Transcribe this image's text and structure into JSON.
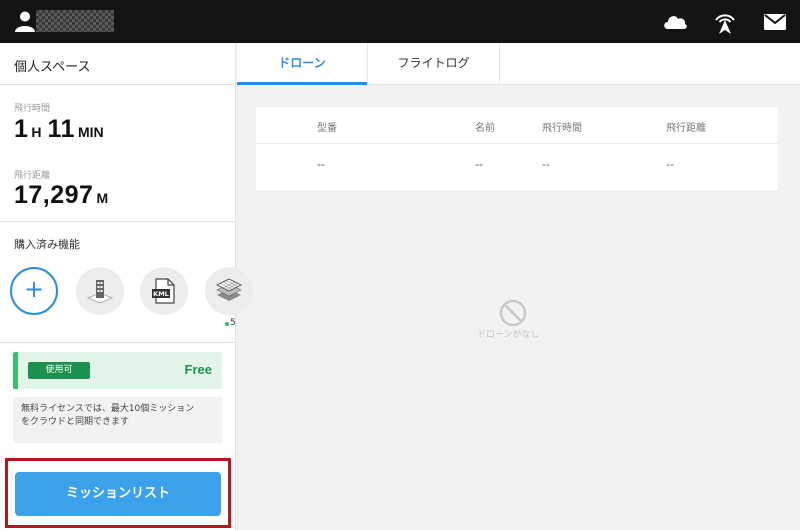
{
  "topbar": {
    "icons": [
      "user-icon",
      "cloud-icon",
      "drone-sync-icon",
      "mail-icon"
    ]
  },
  "sidebar": {
    "title": "個人スペース",
    "flight_time": {
      "label": "飛行時間",
      "hours": "1",
      "hours_unit": "H",
      "minutes": "11",
      "minutes_unit": "MIN"
    },
    "flight_distance": {
      "label": "飛行距離",
      "value": "17,297",
      "unit": "M"
    },
    "features": {
      "title": "購入済み機能",
      "items": [
        "add-icon",
        "building-icon",
        "kml-file-icon",
        "map-layers-icon"
      ],
      "count": "5"
    },
    "license": {
      "badge": "使用可",
      "plan": "Free",
      "note_line1": "無料ライセンスでは、最大10個ミッション",
      "note_line2": "をクラウドと同期できます"
    },
    "mission_list_button": "ミッションリスト"
  },
  "main": {
    "tabs": [
      {
        "label": "ドローン",
        "active": true
      },
      {
        "label": "フライトログ",
        "active": false
      }
    ],
    "table": {
      "columns": [
        "型番",
        "名前",
        "飛行時間",
        "飛行距離"
      ],
      "rows": [
        [
          "--",
          "--",
          "--",
          "--"
        ]
      ]
    },
    "empty_state": "ドローンがなし"
  },
  "colors": {
    "accent": "#2d8be3",
    "button": "#3aa2ea",
    "license_green": "#1e9150",
    "highlight": "#b7161b"
  }
}
